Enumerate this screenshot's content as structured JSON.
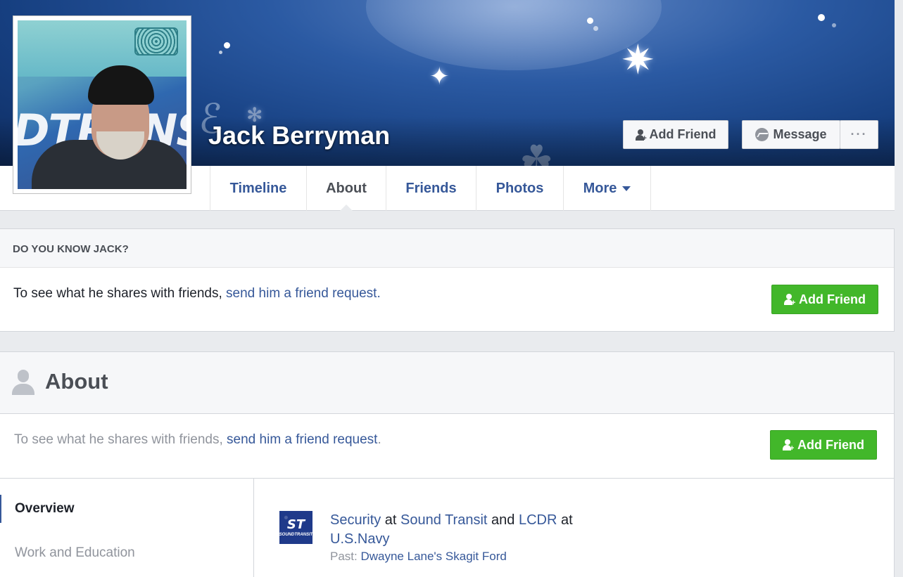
{
  "profile": {
    "name": "Jack Berryman",
    "photo_letters": "DTRANS"
  },
  "cover": {
    "buttons": {
      "add_friend": "Add Friend",
      "message": "Message",
      "more": "···"
    }
  },
  "nav": {
    "tabs": [
      {
        "label": "Timeline"
      },
      {
        "label": "About"
      },
      {
        "label": "Friends"
      },
      {
        "label": "Photos"
      },
      {
        "label": "More"
      }
    ],
    "active": "About"
  },
  "know_card": {
    "header": "DO YOU KNOW JACK?",
    "text_prefix": "To see what he shares with friends, ",
    "link": "send him a friend request.",
    "button": "Add Friend"
  },
  "about_card": {
    "title": "About",
    "text_prefix": "To see what he shares with friends, ",
    "link": "send him a friend request",
    "text_suffix": ".",
    "button": "Add Friend",
    "sections": [
      {
        "label": "Overview"
      },
      {
        "label": "Work and Education"
      }
    ],
    "work": {
      "role1": "Security",
      "at1": " at ",
      "org1": "Sound Transit",
      "and": " and ",
      "role2": "LCDR",
      "at2": " at ",
      "org2": "U.S.Navy",
      "past_label": "Past: ",
      "past_org": "Dwayne Lane's Skagit Ford",
      "logo_mark": "ST",
      "logo_text": "SOUNDTRANSIT"
    }
  },
  "colors": {
    "link": "#365899",
    "green": "#42b72a",
    "background": "#e9ebee"
  }
}
